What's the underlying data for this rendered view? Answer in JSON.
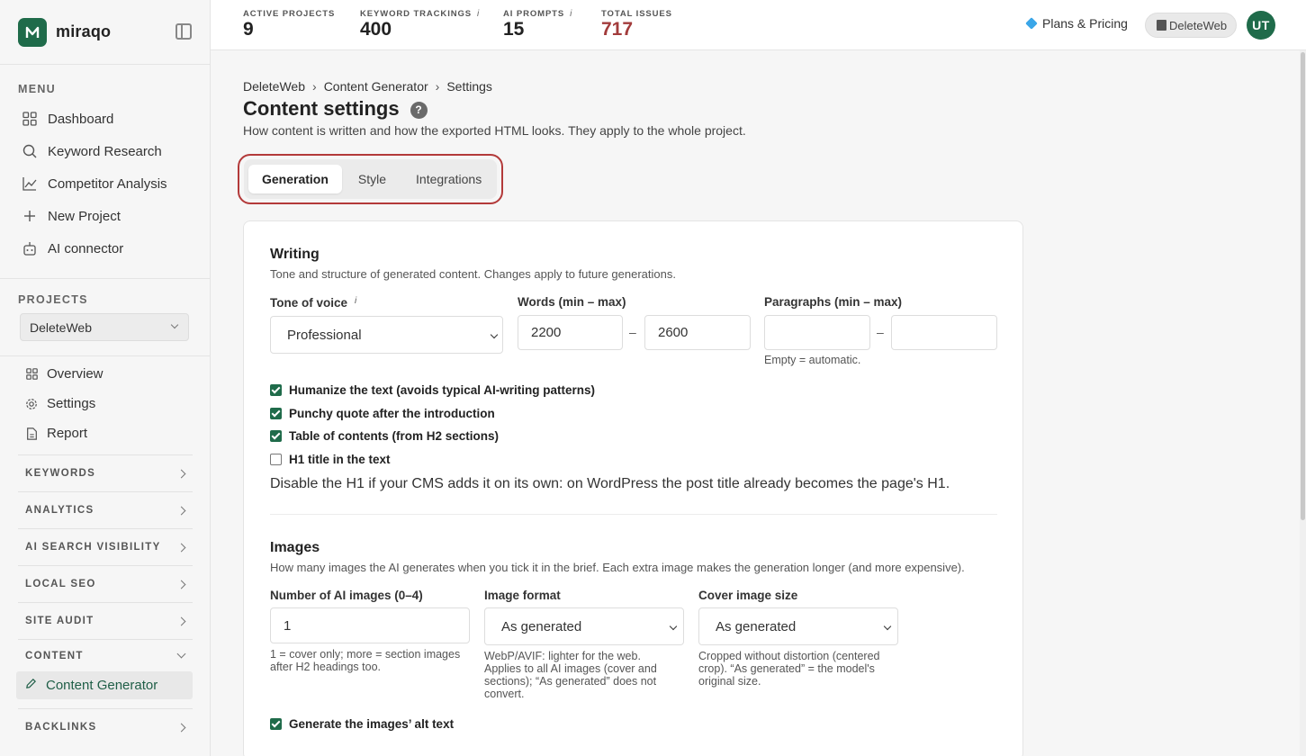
{
  "brand": {
    "name": "miraqo",
    "color": "#1f6b4a"
  },
  "sidebar": {
    "menu_label": "MENU",
    "menu": [
      {
        "label": "Dashboard",
        "icon": "grid-icon"
      },
      {
        "label": "Keyword Research",
        "icon": "search-icon"
      },
      {
        "label": "Competitor Analysis",
        "icon": "chart-line-icon"
      },
      {
        "label": "New Project",
        "icon": "plus-icon"
      },
      {
        "label": "AI connector",
        "icon": "robot-icon"
      }
    ],
    "projects_label": "PROJECTS",
    "project_selected": "DeleteWeb",
    "project_items": [
      {
        "label": "Overview",
        "icon": "grid-icon"
      },
      {
        "label": "Settings",
        "icon": "gear-icon"
      },
      {
        "label": "Report",
        "icon": "document-icon"
      }
    ],
    "groups": [
      {
        "label": "KEYWORDS"
      },
      {
        "label": "ANALYTICS"
      },
      {
        "label": "AI SEARCH VISIBILITY"
      },
      {
        "label": "LOCAL SEO"
      },
      {
        "label": "SITE AUDIT"
      },
      {
        "label": "CONTENT"
      }
    ],
    "active_item": "Content Generator",
    "last_group": "BACKLINKS"
  },
  "topbar": {
    "stats": [
      {
        "label": "ACTIVE PROJECTS",
        "value": "9",
        "info": ""
      },
      {
        "label": "KEYWORD TRACKINGS",
        "value": "400",
        "info": "i"
      },
      {
        "label": "AI PROMPTS",
        "value": "15",
        "info": "i"
      },
      {
        "label": "TOTAL ISSUES",
        "value": "717",
        "info": ""
      }
    ],
    "issues_color": "#a23b3b",
    "plans_label": "Plans & Pricing",
    "project_pill": "DeleteWeb",
    "avatar_initials": "UT"
  },
  "breadcrumb": [
    "DeleteWeb",
    "Content Generator",
    "Settings"
  ],
  "page": {
    "title": "Content settings",
    "help": "?",
    "subtitle": "How content is written and how the exported HTML looks. They apply to the whole project."
  },
  "tabs": [
    {
      "label": "Generation",
      "active": true
    },
    {
      "label": "Style",
      "active": false
    },
    {
      "label": "Integrations",
      "active": false
    }
  ],
  "writing": {
    "title": "Writing",
    "desc": "Tone and structure of generated content. Changes apply to future generations.",
    "tone_label": "Tone of voice",
    "tone_info": "i",
    "tone_value": "Professional",
    "words_label": "Words (min – max)",
    "words_min": "2200",
    "words_max": "2600",
    "paragraphs_label": "Paragraphs (min – max)",
    "paragraphs_min": "",
    "paragraphs_max": "",
    "paragraphs_hint": "Empty = automatic.",
    "range_sep": "–",
    "checkboxes": [
      {
        "label": "Humanize the text (avoids typical AI-writing patterns)",
        "checked": true
      },
      {
        "label": "Punchy quote after the introduction",
        "checked": true
      },
      {
        "label": "Table of contents (from H2 sections)",
        "checked": true
      },
      {
        "label": "H1 title in the text",
        "checked": false
      }
    ],
    "h1_note": "Disable the H1 if your CMS adds it on its own: on WordPress the post title already becomes the page's H1."
  },
  "images": {
    "title": "Images",
    "desc": "How many images the AI generates when you tick it in the brief. Each extra image makes the generation longer (and more expensive).",
    "count_label": "Number of AI images (0–4)",
    "count_value": "1",
    "count_hint": "1 = cover only; more = section images after H2 headings too.",
    "format_label": "Image format",
    "format_value": "As generated",
    "format_hint": "WebP/AVIF: lighter for the web. Applies to all AI images (cover and sections); “As generated” does not convert.",
    "cover_label": "Cover image size",
    "cover_value": "As generated",
    "cover_hint": "Cropped without distortion (centered crop). “As generated” = the model's original size.",
    "alt_label": "Generate the images’ alt text",
    "alt_checked": true
  }
}
